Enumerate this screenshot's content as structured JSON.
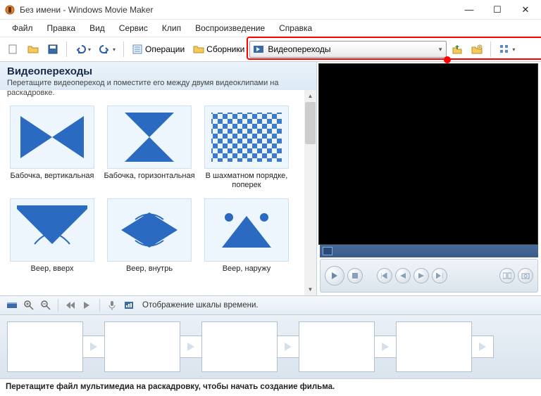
{
  "window": {
    "title": "Без имени - Windows Movie Maker"
  },
  "menu": {
    "file": "Файл",
    "edit": "Правка",
    "view": "Вид",
    "tools": "Сервис",
    "clip": "Клип",
    "play": "Воспроизведение",
    "help": "Справка"
  },
  "toolbar": {
    "tasks_label": "Операции",
    "collections_label": "Сборники",
    "combo_value": "Видеопереходы"
  },
  "panel": {
    "title": "Видеопереходы",
    "hint": "Перетащите видеопереход и поместите его между двумя видеоклипами на раскадровке.",
    "items": [
      {
        "label": "Бабочка, вертикальная"
      },
      {
        "label": "Бабочка, горизонтальная"
      },
      {
        "label": "В шахматном порядке, поперек"
      },
      {
        "label": "Веер, вверх"
      },
      {
        "label": "Веер, внутрь"
      },
      {
        "label": "Веер, наружу"
      }
    ]
  },
  "timeline": {
    "toolbar_label": "Отображение шкалы времени."
  },
  "status": {
    "text": "Перетащите файл мультимедиа на раскадровку, чтобы начать создание фильма."
  }
}
